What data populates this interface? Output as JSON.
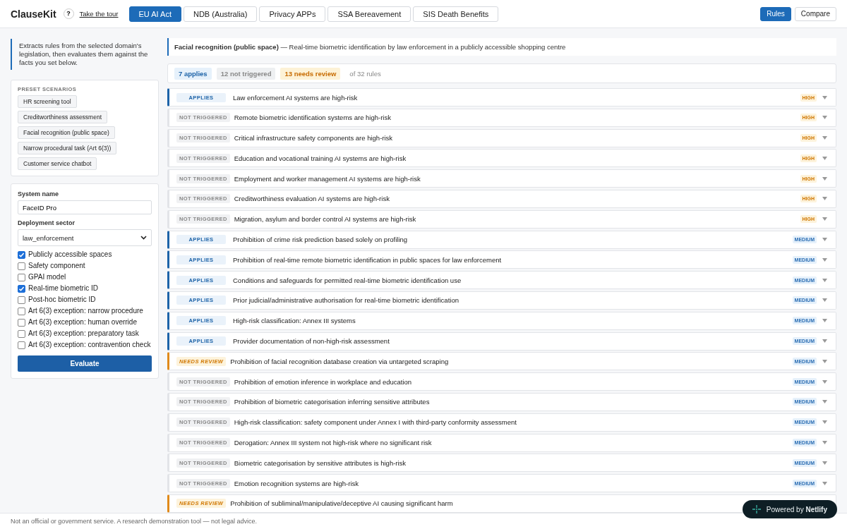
{
  "header": {
    "brand": "ClauseKit",
    "help": "?",
    "tour_link": "Take the tour",
    "domain_tabs": [
      {
        "label": "EU AI Act",
        "selected": true
      },
      {
        "label": "NDB (Australia)",
        "selected": false
      },
      {
        "label": "Privacy APPs",
        "selected": false
      },
      {
        "label": "SSA Bereavement",
        "selected": false
      },
      {
        "label": "SIS Death Benefits",
        "selected": false
      }
    ],
    "view_tabs": [
      {
        "label": "Rules",
        "selected": true
      },
      {
        "label": "Compare",
        "selected": false
      }
    ]
  },
  "sidebar": {
    "intro": "Extracts rules from the selected domain's legislation, then evaluates them against the facts you set below.",
    "presets": {
      "heading": "PRESET SCENARIOS",
      "items": [
        "HR screening tool",
        "Creditworthiness assessment",
        "Facial recognition (public space)",
        "Narrow procedural task (Art 6(3))",
        "Customer service chatbot"
      ]
    },
    "form": {
      "system_name_label": "System name",
      "system_name_value": "FaceID Pro",
      "sector_label": "Deployment sector",
      "sector_value": "law_enforcement",
      "facts": [
        {
          "label": "Publicly accessible spaces",
          "checked": true
        },
        {
          "label": "Safety component",
          "checked": false
        },
        {
          "label": "GPAI model",
          "checked": false
        },
        {
          "label": "Real-time biometric ID",
          "checked": true
        },
        {
          "label": "Post-hoc biometric ID",
          "checked": false
        },
        {
          "label": "Art 6(3) exception: narrow procedure",
          "checked": false
        },
        {
          "label": "Art 6(3) exception: human override",
          "checked": false
        },
        {
          "label": "Art 6(3) exception: preparatory task",
          "checked": false
        },
        {
          "label": "Art 6(3) exception: contravention check",
          "checked": false
        }
      ],
      "submit": "Evaluate"
    }
  },
  "scenario": {
    "title": "Facial recognition (public space)",
    "description": " — Real-time biometric identification by law enforcement in a publicly accessible shopping centre"
  },
  "summary": [
    {
      "kind": "applies",
      "text": "7 applies"
    },
    {
      "kind": "not_triggered",
      "text": "12 not triggered"
    },
    {
      "kind": "needs_review",
      "text": "13 needs review"
    },
    {
      "kind": "total",
      "text": "of 32 rules"
    }
  ],
  "rules": [
    {
      "kind": "applies",
      "status": "APPLIES",
      "title": "Law enforcement AI systems are high-risk",
      "severity": {
        "kind": "high",
        "label": "HIGH"
      }
    },
    {
      "kind": "not_triggered",
      "status": "NOT TRIGGERED",
      "title": "Remote biometric identification systems are high-risk",
      "severity": {
        "kind": "high",
        "label": "HIGH"
      }
    },
    {
      "kind": "not_triggered",
      "status": "NOT TRIGGERED",
      "title": "Critical infrastructure safety components are high-risk",
      "severity": {
        "kind": "high",
        "label": "HIGH"
      }
    },
    {
      "kind": "not_triggered",
      "status": "NOT TRIGGERED",
      "title": "Education and vocational training AI systems are high-risk",
      "severity": {
        "kind": "high",
        "label": "HIGH"
      }
    },
    {
      "kind": "not_triggered",
      "status": "NOT TRIGGERED",
      "title": "Employment and worker management AI systems are high-risk",
      "severity": {
        "kind": "high",
        "label": "HIGH"
      }
    },
    {
      "kind": "not_triggered",
      "status": "NOT TRIGGERED",
      "title": "Creditworthiness evaluation AI systems are high-risk",
      "severity": {
        "kind": "high",
        "label": "HIGH"
      }
    },
    {
      "kind": "not_triggered",
      "status": "NOT TRIGGERED",
      "title": "Migration, asylum and border control AI systems are high-risk",
      "severity": {
        "kind": "high",
        "label": "HIGH"
      }
    },
    {
      "kind": "applies",
      "status": "APPLIES",
      "title": "Prohibition of crime risk prediction based solely on profiling",
      "severity": {
        "kind": "medium",
        "label": "MEDIUM"
      }
    },
    {
      "kind": "applies",
      "status": "APPLIES",
      "title": "Prohibition of real-time remote biometric identification in public spaces for law enforcement",
      "severity": {
        "kind": "medium",
        "label": "MEDIUM"
      }
    },
    {
      "kind": "applies",
      "status": "APPLIES",
      "title": "Conditions and safeguards for permitted real-time biometric identification use",
      "severity": {
        "kind": "medium",
        "label": "MEDIUM"
      }
    },
    {
      "kind": "applies",
      "status": "APPLIES",
      "title": "Prior judicial/administrative authorisation for real-time biometric identification",
      "severity": {
        "kind": "medium",
        "label": "MEDIUM"
      }
    },
    {
      "kind": "applies",
      "status": "APPLIES",
      "title": "High-risk classification: Annex III systems",
      "severity": {
        "kind": "medium",
        "label": "MEDIUM"
      }
    },
    {
      "kind": "applies",
      "status": "APPLIES",
      "title": "Provider documentation of non-high-risk assessment",
      "severity": {
        "kind": "medium",
        "label": "MEDIUM"
      }
    },
    {
      "kind": "needs_review",
      "status": "NEEDS REVIEW",
      "title": "Prohibition of facial recognition database creation via untargeted scraping",
      "severity": {
        "kind": "medium",
        "label": "MEDIUM"
      }
    },
    {
      "kind": "not_triggered",
      "status": "NOT TRIGGERED",
      "title": "Prohibition of emotion inference in workplace and education",
      "severity": {
        "kind": "medium",
        "label": "MEDIUM"
      }
    },
    {
      "kind": "not_triggered",
      "status": "NOT TRIGGERED",
      "title": "Prohibition of biometric categorisation inferring sensitive attributes",
      "severity": {
        "kind": "medium",
        "label": "MEDIUM"
      }
    },
    {
      "kind": "not_triggered",
      "status": "NOT TRIGGERED",
      "title": "High-risk classification: safety component under Annex I with third-party conformity assessment",
      "severity": {
        "kind": "medium",
        "label": "MEDIUM"
      }
    },
    {
      "kind": "not_triggered",
      "status": "NOT TRIGGERED",
      "title": "Derogation: Annex III system not high-risk where no significant risk",
      "severity": {
        "kind": "medium",
        "label": "MEDIUM"
      }
    },
    {
      "kind": "not_triggered",
      "status": "NOT TRIGGERED",
      "title": "Biometric categorisation by sensitive attributes is high-risk",
      "severity": {
        "kind": "medium",
        "label": "MEDIUM"
      }
    },
    {
      "kind": "not_triggered",
      "status": "NOT TRIGGERED",
      "title": "Emotion recognition systems are high-risk",
      "severity": {
        "kind": "medium",
        "label": "MEDIUM"
      }
    },
    {
      "kind": "needs_review",
      "status": "NEEDS REVIEW",
      "title": "Prohibition of subliminal/manipulative/deceptive AI causing significant harm"
    }
  ],
  "footer": {
    "disclaimer": "Not an official or government service. A research demonstration tool — not legal advice.",
    "netlify_badge": {
      "prefix": "Powered by ",
      "brand": "Netlify"
    }
  }
}
